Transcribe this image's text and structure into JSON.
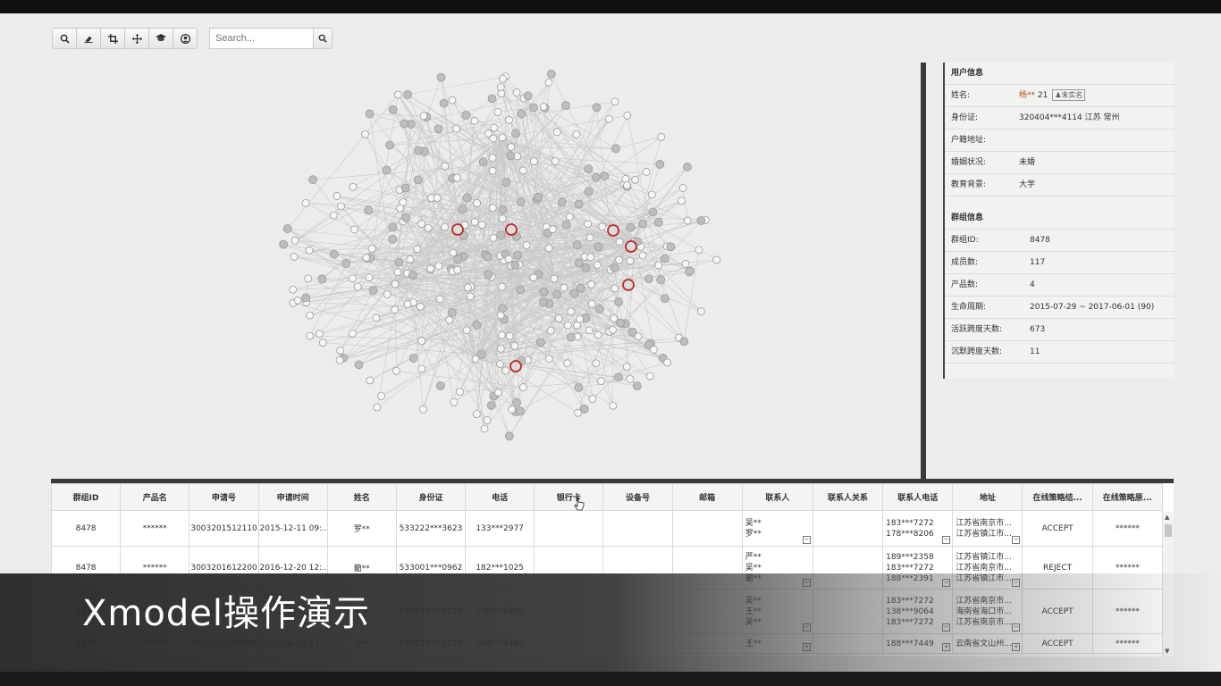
{
  "toolbar": {
    "tools": [
      "search-icon",
      "eraser-icon",
      "crop-icon",
      "move-icon",
      "graduation-cap-icon",
      "user-circle-icon"
    ],
    "search_placeholder": "Search..."
  },
  "graph": {
    "highlighted_nodes": 6,
    "node_color": "#9a9a9a",
    "highlight_color": "#c0262b"
  },
  "user_info": {
    "title": "用户信息",
    "name_label": "姓名:",
    "name_value": "杨**",
    "age": "21",
    "realname_tag": "未实名",
    "id_label": "身份证:",
    "id_value": "320404***4114 江苏 常州",
    "address_label": "户籍地址:",
    "address_value": "",
    "marriage_label": "婚姻状况:",
    "marriage_value": "未婚",
    "education_label": "教育背景:",
    "education_value": "大学"
  },
  "group_info": {
    "title": "群组信息",
    "rows": [
      {
        "label": "群组ID:",
        "value": "8478"
      },
      {
        "label": "成员数:",
        "value": "117"
      },
      {
        "label": "产品数:",
        "value": "4"
      },
      {
        "label": "生命周期:",
        "value": "2015-07-29 ~ 2017-06-01 (90)"
      },
      {
        "label": "活跃跨度天数:",
        "value": "673"
      },
      {
        "label": "沉默跨度天数:",
        "value": "11"
      }
    ]
  },
  "table": {
    "headers": [
      "群组ID",
      "产品名",
      "申请号",
      "申请时间",
      "姓名",
      "身份证",
      "电话",
      "银行卡",
      "设备号",
      "邮箱",
      "联系人",
      "联系人关系",
      "联系人电话",
      "地址",
      "在线策略结...",
      "在线策略原..."
    ],
    "rows": [
      {
        "group_id": "8478",
        "product": "******",
        "app_no": "3003201512110...",
        "app_time": "2015-12-11 09:...",
        "name": "罗**",
        "id_card": "533222***3623",
        "phone": "133***2977",
        "bank": "",
        "device": "",
        "email": "",
        "contacts": [
          "吴**",
          "罗**"
        ],
        "relation": "",
        "contact_phones": [
          "183***7272",
          "178***8206"
        ],
        "address": [
          "江苏省南京市...",
          "江苏省镇江市..."
        ],
        "result": "ACCEPT",
        "reason": "******"
      },
      {
        "group_id": "8478",
        "product": "******",
        "app_no": "3003201612200...",
        "app_time": "2016-12-20 12:...",
        "name": "藺**",
        "id_card": "533001***0962",
        "phone": "182***1025",
        "bank": "",
        "device": "",
        "email": "",
        "contacts": [
          "严**",
          "吴**",
          "藺**"
        ],
        "relation": "",
        "contact_phones": [
          "189***2358",
          "183***7272",
          "188***2391"
        ],
        "address": [
          "江苏省镇江市...",
          "江苏省南京市...",
          "江苏省镇江市..."
        ],
        "result": "REJECT",
        "reason": "******"
      },
      {
        "group_id": "8478",
        "product": "******",
        "app_no": "3003201...",
        "app_time": "2016-...",
        "name": "王**",
        "id_card": "532625***1529",
        "phone": "130***8200",
        "bank": "",
        "device": "",
        "email": "",
        "contacts": [
          "吴**",
          "王**",
          "吴**"
        ],
        "relation": "",
        "contact_phones": [
          "183***7272",
          "138***9064",
          "183***7272"
        ],
        "address": [
          "江苏省南京市...",
          "海南省海口市...",
          "江苏省南京市..."
        ],
        "result": "ACCEPT",
        "reason": "******"
      },
      {
        "group_id": "8478",
        "product": "******",
        "app_no": "3003201508030...",
        "app_time": "2015-08-03 01:...",
        "name": "王**",
        "id_card": "532625***1525",
        "phone": "188***7449",
        "bank": "",
        "device": "",
        "email": "",
        "contacts": [
          "王**"
        ],
        "relation": "",
        "contact_phones": [
          "188***7449"
        ],
        "address": [
          "云南省文山州..."
        ],
        "result": "ACCEPT",
        "reason": "******"
      }
    ]
  },
  "caption": "Xmodel操作演示"
}
